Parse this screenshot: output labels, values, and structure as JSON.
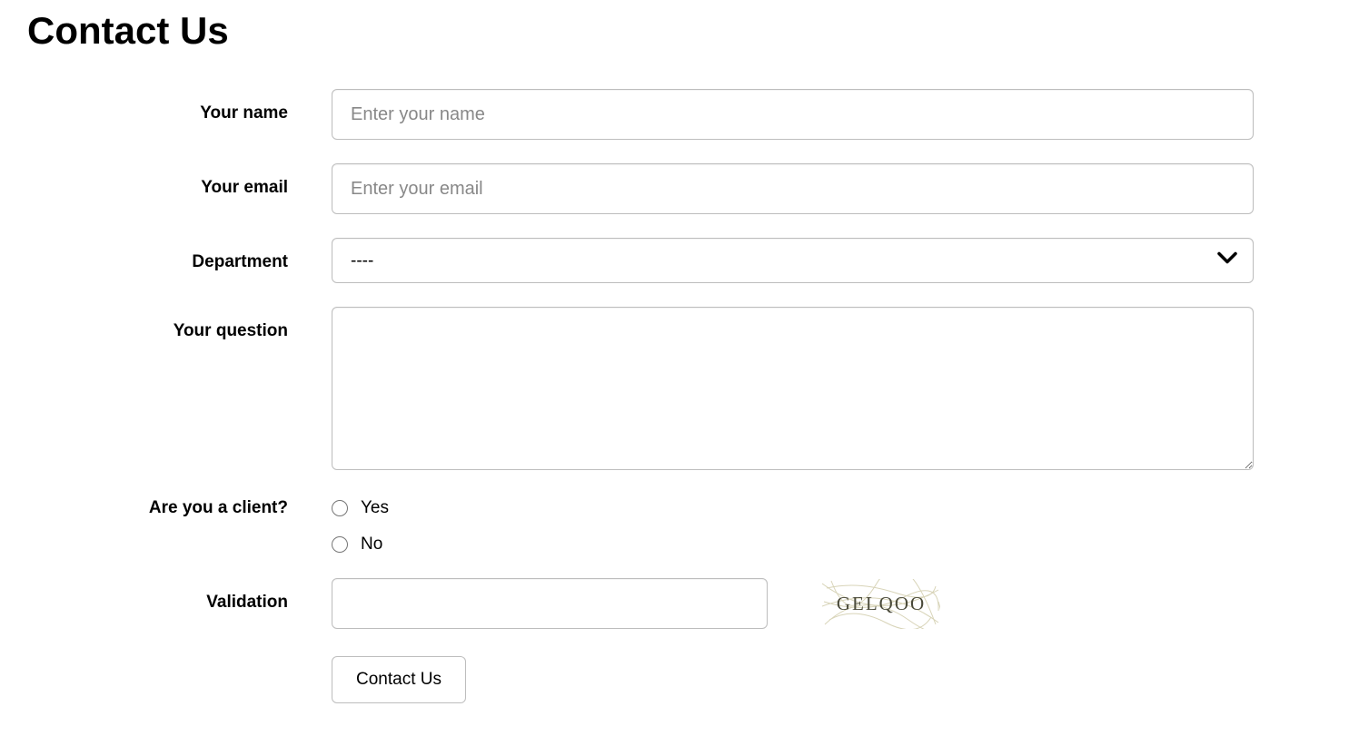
{
  "page": {
    "title": "Contact Us"
  },
  "form": {
    "name": {
      "label": "Your name",
      "placeholder": "Enter your name",
      "value": ""
    },
    "email": {
      "label": "Your email",
      "placeholder": "Enter your email",
      "value": ""
    },
    "department": {
      "label": "Department",
      "selected": "----"
    },
    "question": {
      "label": "Your question",
      "value": ""
    },
    "client": {
      "label": "Are you a client?",
      "options": {
        "yes": "Yes",
        "no": "No"
      }
    },
    "validation": {
      "label": "Validation",
      "value": "",
      "captcha_text": "GELQOO"
    },
    "submit": {
      "label": "Contact Us"
    }
  }
}
